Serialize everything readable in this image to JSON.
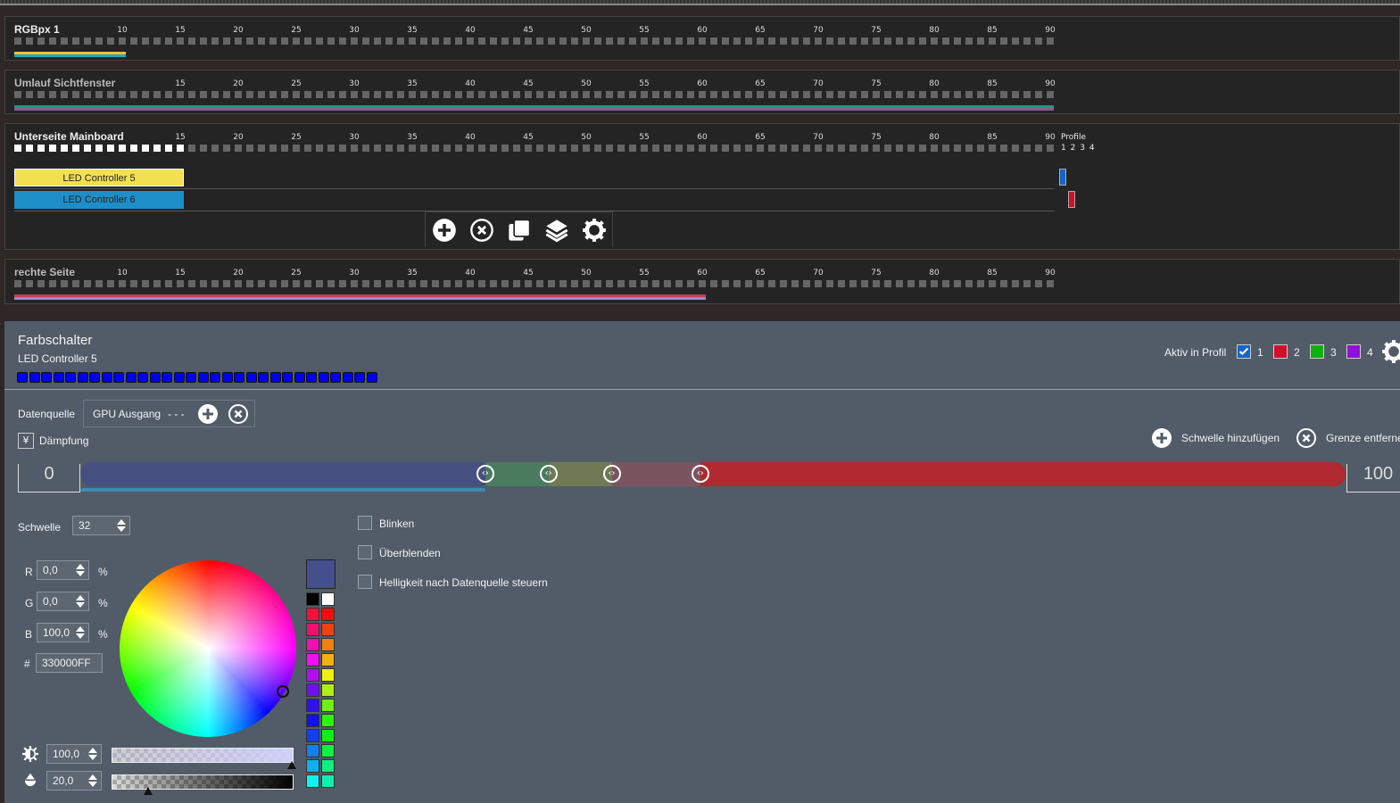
{
  "led_count": 90,
  "strips": [
    {
      "title": "RGBpx 1",
      "ticks": [
        10,
        15,
        20,
        25,
        30,
        35,
        40,
        45,
        50,
        55,
        60,
        65,
        70,
        75,
        80,
        85,
        90
      ],
      "lit": 0,
      "lines": [
        {
          "color": "#f2c230",
          "to": 10
        },
        {
          "color": "#10aad0",
          "to": 10
        }
      ]
    },
    {
      "title": "Umlauf Sichtfenster",
      "ticks": [
        15,
        20,
        25,
        30,
        35,
        40,
        45,
        50,
        55,
        60,
        65,
        70,
        75,
        80,
        85,
        90
      ],
      "lit": 0,
      "lines": [
        {
          "color": "#1e9a82",
          "to": 90
        },
        {
          "color": "#8a5a8e",
          "to": 90
        }
      ]
    },
    {
      "title": "Unterseite Mainboard",
      "ticks": [
        15,
        20,
        25,
        30,
        35,
        40,
        45,
        50,
        55,
        60,
        65,
        70,
        75,
        80,
        85,
        90
      ],
      "lit": 15,
      "lines": []
    },
    {
      "title": "rechte Seite",
      "ticks": [
        10,
        15,
        20,
        25,
        30,
        35,
        40,
        45,
        50,
        55,
        60,
        65,
        70,
        75,
        80,
        85,
        90
      ],
      "lit": 0,
      "lines": [
        {
          "color": "#c0404a",
          "to": 60
        },
        {
          "color": "#9c8ac8",
          "to": 60
        }
      ]
    }
  ],
  "mainboard": {
    "profile_label": "Profile",
    "profile_nums": [
      "1",
      "2",
      "3",
      "4"
    ],
    "controllers": [
      {
        "label": "LED Controller 5",
        "color": "#f2e050",
        "profile_color": "#1565c8"
      },
      {
        "label": "LED Controller 6",
        "color": "#1e8ec8",
        "profile_color": "#d0102a"
      }
    ]
  },
  "panel": {
    "title": "Farbschalter",
    "subtitle": "LED Controller 5",
    "led_count": 30,
    "led_color": "#0000ee",
    "aktiv_label": "Aktiv in Profil",
    "profiles": [
      {
        "n": "1",
        "color": "#1565c8",
        "checked": true
      },
      {
        "n": "2",
        "color": "#d0102a"
      },
      {
        "n": "3",
        "color": "#10b010"
      },
      {
        "n": "4",
        "color": "#9010d8"
      }
    ],
    "datenquelle_label": "Datenquelle",
    "datenquelle_value": "GPU Ausgang",
    "datenquelle_dashes": "- - -",
    "daempfung_label": "Dämpfung",
    "add_threshold": "Schwelle hinzufügen",
    "remove_limit": "Grenze entfernen",
    "range_min": "0",
    "range_max": "100",
    "segments": [
      {
        "to": 32,
        "color": "#454f80"
      },
      {
        "to": 37,
        "color": "#4a7b5e"
      },
      {
        "to": 42,
        "color": "#6f7a55"
      },
      {
        "to": 49,
        "color": "#7a5560"
      },
      {
        "to": 100,
        "color": "#b02830"
      }
    ],
    "schwelle_label": "Schwelle",
    "schwelle_value": "32",
    "r_label": "R",
    "r_value": "0,0",
    "g_label": "G",
    "g_value": "0,0",
    "b_label": "B",
    "b_value": "100,0",
    "pct": "%",
    "hex_label": "#",
    "hex_value": "330000FF",
    "brightness_value": "100,0",
    "alpha_value": "20,0",
    "checks": [
      "Blinken",
      "Überblenden",
      "Helligkeit nach Datenquelle steuern"
    ],
    "preview_color": "#454f8c",
    "palette_left": [
      "#000000",
      "#f0103c",
      "#f01070",
      "#f010b0",
      "#f010f0",
      "#b010f0",
      "#7010f0",
      "#3010f0",
      "#1010f0",
      "#1040f0",
      "#1080f0",
      "#10b0f0",
      "#10f0f0"
    ],
    "palette_right": [
      "#ffffff",
      "#f01010",
      "#f04010",
      "#f08010",
      "#f0b010",
      "#f0f010",
      "#b0f010",
      "#70f010",
      "#30f010",
      "#10f010",
      "#10f040",
      "#10f080",
      "#10f0b0"
    ]
  }
}
